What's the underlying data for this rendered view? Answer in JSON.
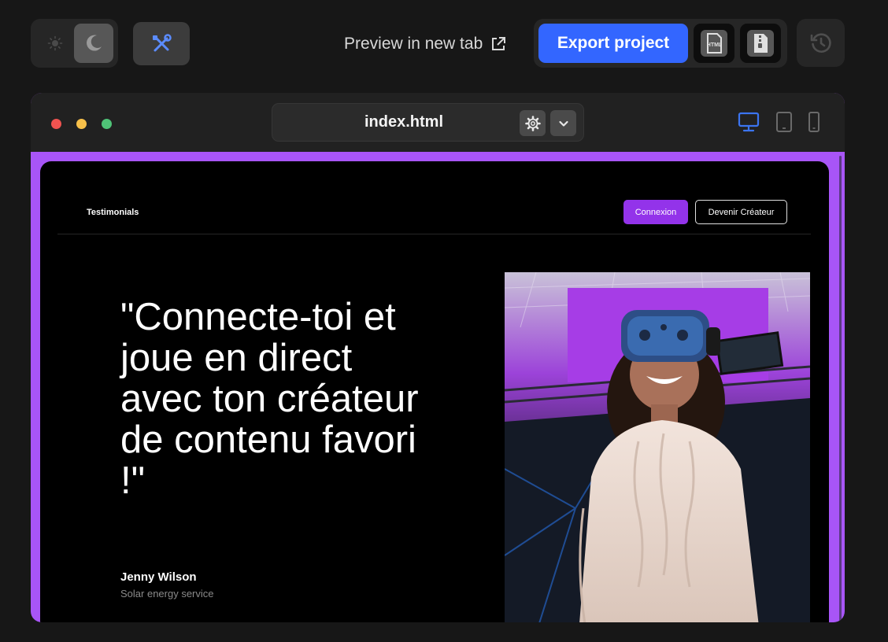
{
  "toolbar": {
    "theme": {
      "light_icon": "sun-icon",
      "dark_icon": "moon-icon",
      "selected": "dark"
    },
    "tools_icon": "tools-icon",
    "preview_label": "Preview in new tab",
    "preview_icon": "external-link-icon",
    "export_label": "Export project",
    "download_html_icon": "html-file-icon",
    "download_html_text": "HTML",
    "download_zip_icon": "zip-file-icon",
    "history_icon": "history-icon",
    "accent_color": "#3366ff"
  },
  "window": {
    "file_name": "index.html",
    "settings_icon": "gear-icon",
    "dropdown_icon": "chevron-down-icon",
    "devices": [
      "desktop",
      "tablet",
      "mobile"
    ],
    "selected_device": "desktop",
    "frame_color": "#a855f7"
  },
  "page": {
    "nav_title": "Testimonials",
    "login_label": "Connexion",
    "creator_label": "Devenir Créateur",
    "quote": "\"Connecte-toi et joue en direct avec ton créateur de contenu favori !\"",
    "author_name": "Jenny Wilson",
    "author_role": "Solar energy service",
    "photo_description": "person-wearing-vr-headset",
    "brand_color": "#9333ea"
  }
}
